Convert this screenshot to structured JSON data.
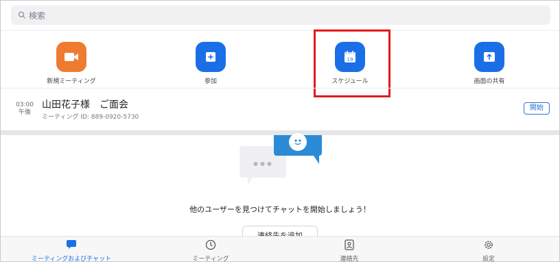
{
  "search": {
    "placeholder": "検索"
  },
  "actions": [
    {
      "label": "新規ミーティング",
      "icon": "video-camera-icon",
      "color": "#ef7b31"
    },
    {
      "label": "参加",
      "icon": "plus-icon",
      "color": "#1b6fe6"
    },
    {
      "label": "スケジュール",
      "icon": "calendar-icon",
      "color": "#1b6fe6",
      "calendar_day": "19",
      "highlighted": true
    },
    {
      "label": "画面の共有",
      "icon": "share-screen-icon",
      "color": "#1b6fe6"
    }
  ],
  "meeting": {
    "time": "03:00",
    "ampm": "午後",
    "title": "山田花子様　ご面会",
    "id": "ミーティング ID: 889-0920-5730",
    "start_label": "開始"
  },
  "chat_empty": {
    "message": "他のユーザーを見つけてチャットを開始しましょう！",
    "button_label": "連絡先を追加"
  },
  "tabs": [
    {
      "label": "ミーティングおよびチャット",
      "icon": "chat-bubble-icon",
      "active": true
    },
    {
      "label": "ミーティング",
      "icon": "clock-icon",
      "active": false
    },
    {
      "label": "連絡先",
      "icon": "contact-icon",
      "active": false
    },
    {
      "label": "設定",
      "icon": "gear-icon",
      "active": false
    }
  ],
  "colors": {
    "accent": "#1b6fe6",
    "orange": "#ef7b31",
    "highlight": "#e11a1a"
  }
}
